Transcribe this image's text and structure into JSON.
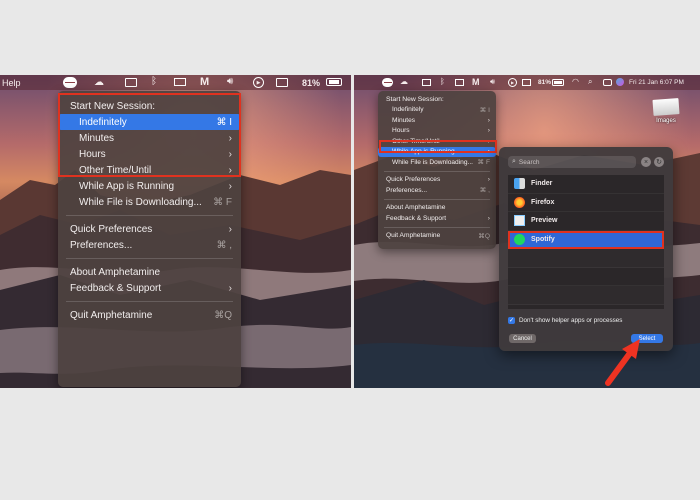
{
  "left": {
    "menubar": {
      "help": "Help",
      "battery": "81%"
    },
    "menu": {
      "header": "Start New Session:",
      "items": [
        {
          "label": "Indefinitely",
          "shortcut": "⌘ I"
        },
        {
          "label": "Minutes",
          "chevron": "›"
        },
        {
          "label": "Hours",
          "chevron": "›"
        },
        {
          "label": "Other Time/Until",
          "chevron": "›"
        },
        {
          "label": "While App is Running",
          "chevron": "›"
        },
        {
          "label": "While File is Downloading...",
          "shortcut": "⌘ F"
        }
      ],
      "group2": [
        {
          "label": "Quick Preferences",
          "chevron": "›"
        },
        {
          "label": "Preferences...",
          "shortcut": "⌘ ,"
        }
      ],
      "group3": [
        {
          "label": "About Amphetamine"
        },
        {
          "label": "Feedback & Support",
          "chevron": "›"
        }
      ],
      "quit": {
        "label": "Quit Amphetamine",
        "shortcut": "⌘Q"
      }
    }
  },
  "right": {
    "menubar": {
      "battery": "81%",
      "datetime": "Fri 21 Jan  6:07 PM"
    },
    "menu": {
      "header": "Start New Session:",
      "items": [
        {
          "label": "Indefinitely",
          "shortcut": "⌘ I"
        },
        {
          "label": "Minutes",
          "chevron": "›"
        },
        {
          "label": "Hours",
          "chevron": "›"
        },
        {
          "label": "Other Time/Until",
          "chevron": "›"
        },
        {
          "label": "While App is Running",
          "chevron": "›"
        },
        {
          "label": "While File is Downloading...",
          "shortcut": "⌘ F"
        }
      ],
      "group2": [
        {
          "label": "Quick Preferences",
          "chevron": "›"
        },
        {
          "label": "Preferences...",
          "shortcut": "⌘ ,"
        }
      ],
      "group3": [
        {
          "label": "About Amphetamine"
        },
        {
          "label": "Feedback & Support",
          "chevron": "›"
        }
      ],
      "quit": {
        "label": "Quit Amphetamine",
        "shortcut": "⌘Q"
      }
    },
    "dialog": {
      "search_placeholder": "Search",
      "apps": [
        "Finder",
        "Firefox",
        "Preview",
        "Spotify"
      ],
      "checkbox_label": "Don't show helper apps or processes",
      "cancel": "Cancel",
      "select": "Select"
    },
    "desktop": {
      "file_label": "Images"
    }
  },
  "colors": {
    "highlight": "#3478e6",
    "annotation": "#e0321f"
  }
}
